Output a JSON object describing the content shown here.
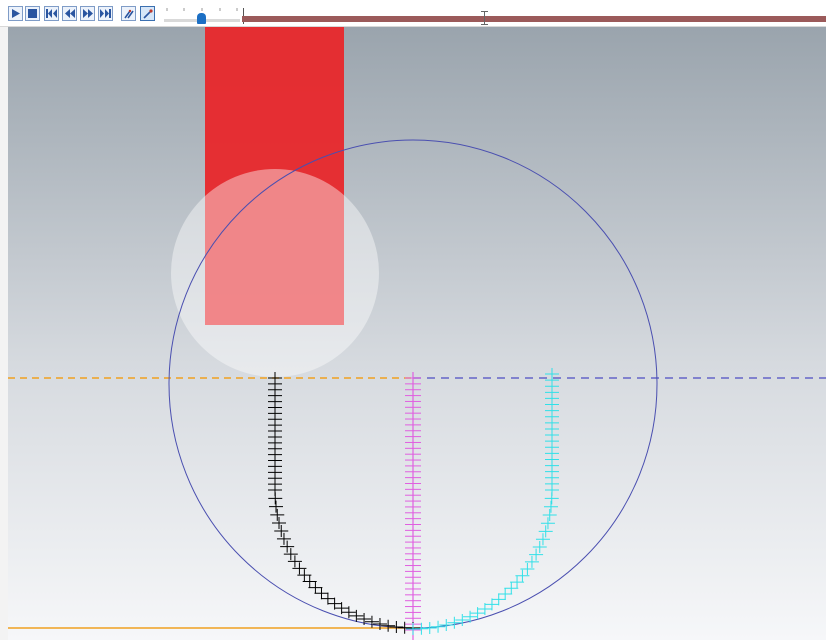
{
  "toolbar": {
    "buttons": [
      {
        "name": "play-button",
        "icon": "play-icon"
      },
      {
        "name": "stop-button",
        "icon": "stop-icon"
      },
      {
        "name": "go-to-start-button",
        "icon": "skip-to-start-icon"
      },
      {
        "name": "step-back-button",
        "icon": "rewind-icon"
      },
      {
        "name": "step-forward-button",
        "icon": "fast-forward-icon"
      },
      {
        "name": "go-to-end-button",
        "icon": "skip-to-end-icon"
      },
      {
        "name": "trace-toggle-button",
        "icon": "trace-paths-icon"
      },
      {
        "name": "tool-toggle-button",
        "icon": "pin-tool-icon",
        "active": true
      }
    ],
    "speed_slider": {
      "level": 0.45
    },
    "timeline": {
      "position": 0.41
    }
  },
  "viewport": {
    "background_top": "#9aa4ad",
    "background_bottom": "#f6f7f9",
    "colors": {
      "link_bar": "#e8272b",
      "joint_highlight": "#ffffff",
      "circle": "#4a4fb0",
      "horizontal_guide": "#f0a020",
      "dashed_guide": "#6464c8",
      "trace_black": "#000000",
      "trace_magenta": "#e060e0",
      "trace_cyan": "#30e0e8"
    }
  }
}
